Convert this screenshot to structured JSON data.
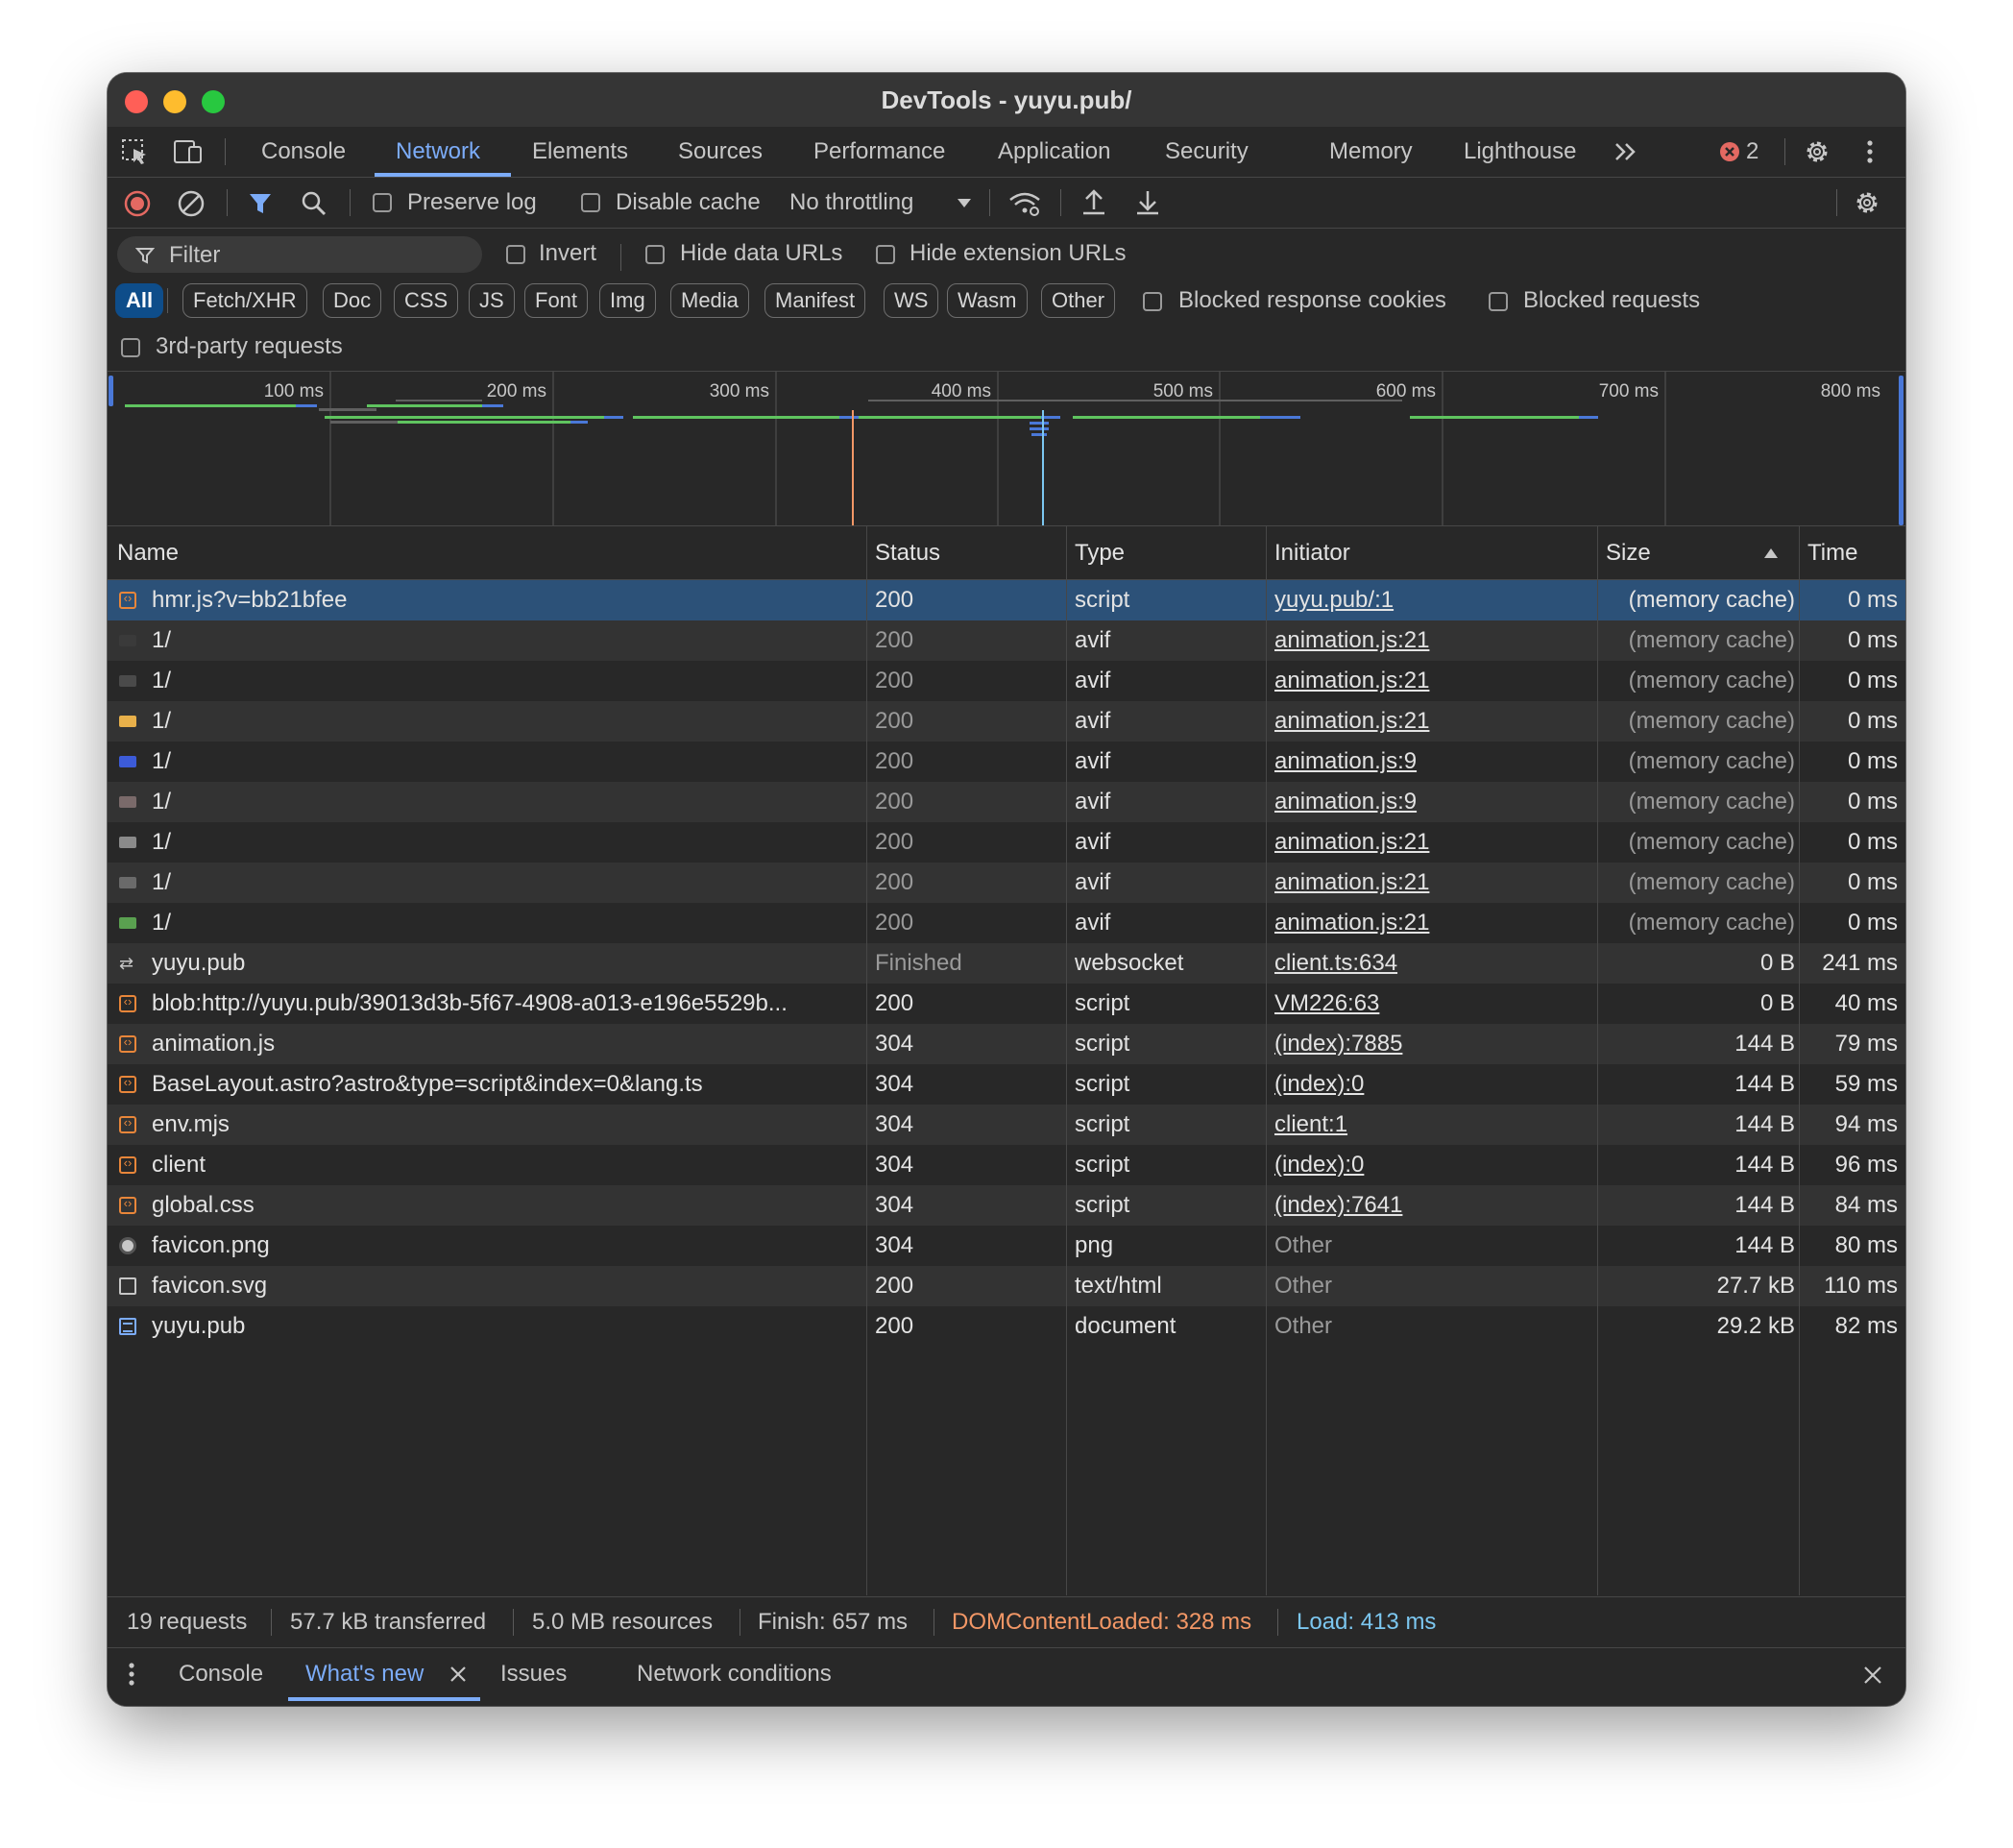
{
  "window": {
    "title": "DevTools - yuyu.pub/"
  },
  "tabs": [
    "Console",
    "Network",
    "Elements",
    "Sources",
    "Performance",
    "Application",
    "Security",
    "Memory",
    "Lighthouse"
  ],
  "active_tab": "Network",
  "error_count": "2",
  "toolbar": {
    "preserve_log": "Preserve log",
    "disable_cache": "Disable cache",
    "throttling": "No throttling"
  },
  "filter": {
    "placeholder": "Filter",
    "invert": "Invert",
    "hide_data_urls": "Hide data URLs",
    "hide_extension_urls": "Hide extension URLs",
    "types": [
      "All",
      "Fetch/XHR",
      "Doc",
      "CSS",
      "JS",
      "Font",
      "Img",
      "Media",
      "Manifest",
      "WS",
      "Wasm",
      "Other"
    ],
    "active_type": "All",
    "blocked_response_cookies": "Blocked response cookies",
    "blocked_requests": "Blocked requests",
    "third_party": "3rd-party requests"
  },
  "overview": {
    "ticks": [
      "100 ms",
      "200 ms",
      "300 ms",
      "400 ms",
      "500 ms",
      "600 ms",
      "700 ms",
      "800 ms"
    ]
  },
  "table": {
    "columns": {
      "name": "Name",
      "status": "Status",
      "type": "Type",
      "initiator": "Initiator",
      "size": "Size",
      "time": "Time"
    },
    "sorted_by": "Size",
    "rows": [
      {
        "icon": "script",
        "name": "hmr.js?v=bb21bfee",
        "status": "200",
        "type": "script",
        "initiator": "yuyu.pub/:1",
        "size": "(memory cache)",
        "time": "0 ms",
        "selected": true
      },
      {
        "icon": "image",
        "name": "1/",
        "status": "200",
        "type": "avif",
        "initiator": "animation.js:21",
        "size": "(memory cache)",
        "time": "0 ms"
      },
      {
        "icon": "image",
        "name": "1/",
        "status": "200",
        "type": "avif",
        "initiator": "animation.js:21",
        "size": "(memory cache)",
        "time": "0 ms"
      },
      {
        "icon": "image",
        "name": "1/",
        "status": "200",
        "type": "avif",
        "initiator": "animation.js:21",
        "size": "(memory cache)",
        "time": "0 ms"
      },
      {
        "icon": "image",
        "name": "1/",
        "status": "200",
        "type": "avif",
        "initiator": "animation.js:9",
        "size": "(memory cache)",
        "time": "0 ms"
      },
      {
        "icon": "image",
        "name": "1/",
        "status": "200",
        "type": "avif",
        "initiator": "animation.js:9",
        "size": "(memory cache)",
        "time": "0 ms"
      },
      {
        "icon": "image",
        "name": "1/",
        "status": "200",
        "type": "avif",
        "initiator": "animation.js:21",
        "size": "(memory cache)",
        "time": "0 ms"
      },
      {
        "icon": "image",
        "name": "1/",
        "status": "200",
        "type": "avif",
        "initiator": "animation.js:21",
        "size": "(memory cache)",
        "time": "0 ms"
      },
      {
        "icon": "image",
        "name": "1/",
        "status": "200",
        "type": "avif",
        "initiator": "animation.js:21",
        "size": "(memory cache)",
        "time": "0 ms"
      },
      {
        "icon": "websocket",
        "name": "yuyu.pub",
        "status": "Finished",
        "type": "websocket",
        "initiator": "client.ts:634",
        "size": "0 B",
        "time": "241 ms"
      },
      {
        "icon": "script",
        "name": "blob:http://yuyu.pub/39013d3b-5f67-4908-a013-e196e5529b...",
        "status": "200",
        "type": "script",
        "initiator": "VM226:63",
        "size": "0 B",
        "time": "40 ms"
      },
      {
        "icon": "script",
        "name": "animation.js",
        "status": "304",
        "type": "script",
        "initiator": "(index):7885",
        "size": "144 B",
        "time": "79 ms"
      },
      {
        "icon": "script",
        "name": "BaseLayout.astro?astro&type=script&index=0&lang.ts",
        "status": "304",
        "type": "script",
        "initiator": "(index):0",
        "size": "144 B",
        "time": "59 ms"
      },
      {
        "icon": "script",
        "name": "env.mjs",
        "status": "304",
        "type": "script",
        "initiator": "client:1",
        "size": "144 B",
        "time": "94 ms"
      },
      {
        "icon": "script",
        "name": "client",
        "status": "304",
        "type": "script",
        "initiator": "(index):0",
        "size": "144 B",
        "time": "96 ms"
      },
      {
        "icon": "script",
        "name": "global.css",
        "status": "304",
        "type": "script",
        "initiator": "(index):7641",
        "size": "144 B",
        "time": "84 ms"
      },
      {
        "icon": "favicon",
        "name": "favicon.png",
        "status": "304",
        "type": "png",
        "initiator": "Other",
        "size": "144 B",
        "time": "80 ms"
      },
      {
        "icon": "blank",
        "name": "favicon.svg",
        "status": "200",
        "type": "text/html",
        "initiator": "Other",
        "size": "27.7 kB",
        "time": "110 ms"
      },
      {
        "icon": "document",
        "name": "yuyu.pub",
        "status": "200",
        "type": "document",
        "initiator": "Other",
        "size": "29.2 kB",
        "time": "82 ms"
      }
    ]
  },
  "status_bar": {
    "requests": "19 requests",
    "transferred": "57.7 kB transferred",
    "resources": "5.0 MB resources",
    "finish": "Finish: 657 ms",
    "dom_content_loaded": "DOMContentLoaded: 328 ms",
    "load": "Load: 413 ms"
  },
  "drawer": {
    "tabs": [
      "Console",
      "What's new",
      "Issues",
      "Network conditions"
    ],
    "active_tab": "What's new"
  },
  "colors": {
    "accent": "#7cacf8",
    "selected_row": "#2c5178",
    "dom_content_loaded": "#f29766",
    "load": "#7cc7f0",
    "waterfall_green": "#5fc45f",
    "waterfall_blue": "#4a78d8",
    "error": "#e46962"
  }
}
